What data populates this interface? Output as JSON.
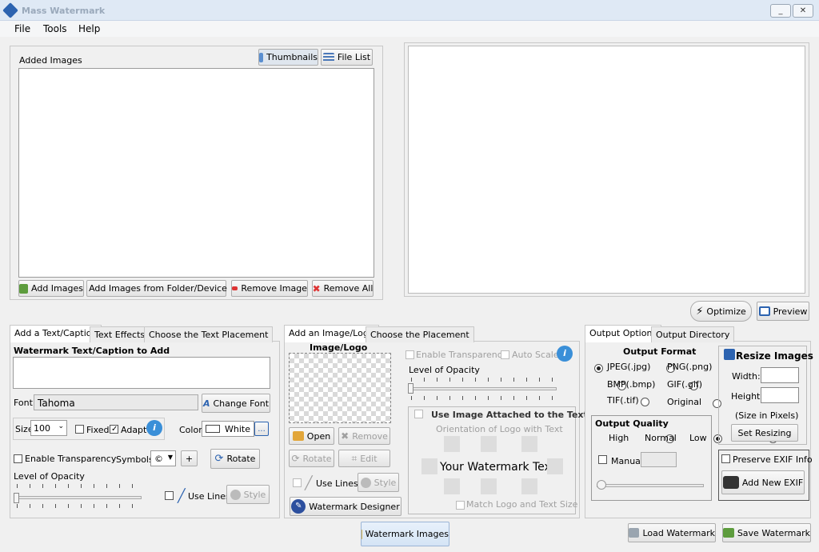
{
  "window": {
    "title": "Mass Watermark",
    "minimize": "_",
    "close": "✕"
  },
  "menu": {
    "file": "File",
    "tools": "Tools",
    "help": "Help"
  },
  "added_images": {
    "title": "Added Images",
    "thumbnails": "Thumbnails",
    "file_list": "File List",
    "add_images": "Add Images",
    "add_from_folder": "Add Images from Folder/Device",
    "remove_image": "Remove Image",
    "remove_all": "Remove All"
  },
  "preview_area": {
    "optimize": "Optimize",
    "preview": "Preview"
  },
  "text_panel": {
    "tabs": [
      "Add a Text/Caption",
      "Text Effects",
      "Choose the Text Placement"
    ],
    "heading": "Watermark Text/Caption to Add",
    "font_label": "Font",
    "font_value": "Tahoma",
    "change_font": "Change Font",
    "size_label": "Size",
    "size_value": "100",
    "fixed": "Fixed",
    "adapt": "Adapt",
    "color_label": "Color",
    "color_value": "White",
    "color_more": "...",
    "enable_transparency": "Enable Transparency",
    "symbols_label": "Symbols",
    "symbols_value": "©",
    "plus": "+",
    "rotate": "Rotate",
    "level_of_opacity": "Level of Opacity",
    "use_lines": "Use Lines",
    "style": "Style"
  },
  "image_panel": {
    "tabs": [
      "Add an Image/Logo",
      "Choose the Placement"
    ],
    "heading": "Image/Logo",
    "enable_transparency": "Enable Transparency",
    "auto_scale": "Auto Scale",
    "level_of_opacity": "Level of Opacity",
    "use_image_attached": "Use Image Attached to the Text",
    "orientation": "Orientation of Logo with Text",
    "your_watermark_text": "Your Watermark Text",
    "match_logo": "Match Logo and Text Size",
    "open": "Open",
    "remove": "Remove",
    "rotate": "Rotate",
    "edit": "Edit",
    "use_lines": "Use Lines",
    "style": "Style",
    "watermark_designer": "Watermark Designer"
  },
  "output_panel": {
    "tabs": [
      "Output Options",
      "Output Directory"
    ],
    "output_format": "Output Format",
    "formats": [
      "JPEG(.jpg)",
      "PNG(.png)",
      "BMP(.bmp)",
      "GIF(.gif)",
      "TIF(.tif)",
      "Original"
    ],
    "output_quality": "Output Quality",
    "high": "High",
    "normal": "Normal",
    "low": "Low",
    "manual": "Manual",
    "resize_images": "Resize Images",
    "width": "Width:",
    "height": "Height:",
    "size_in_pixels": "(Size in Pixels)",
    "set_resizing": "Set Resizing",
    "preserve_exif": "Preserve EXIF Info",
    "add_new_exif": "Add New EXIF"
  },
  "bottom": {
    "watermark_images": "Watermark Images",
    "load_watermark": "Load Watermark",
    "save_watermark": "Save Watermark"
  },
  "colors": {
    "accent": "#2c63b0",
    "title_bg": "#dfe9f5",
    "window_bg": "#f0f0f0"
  }
}
